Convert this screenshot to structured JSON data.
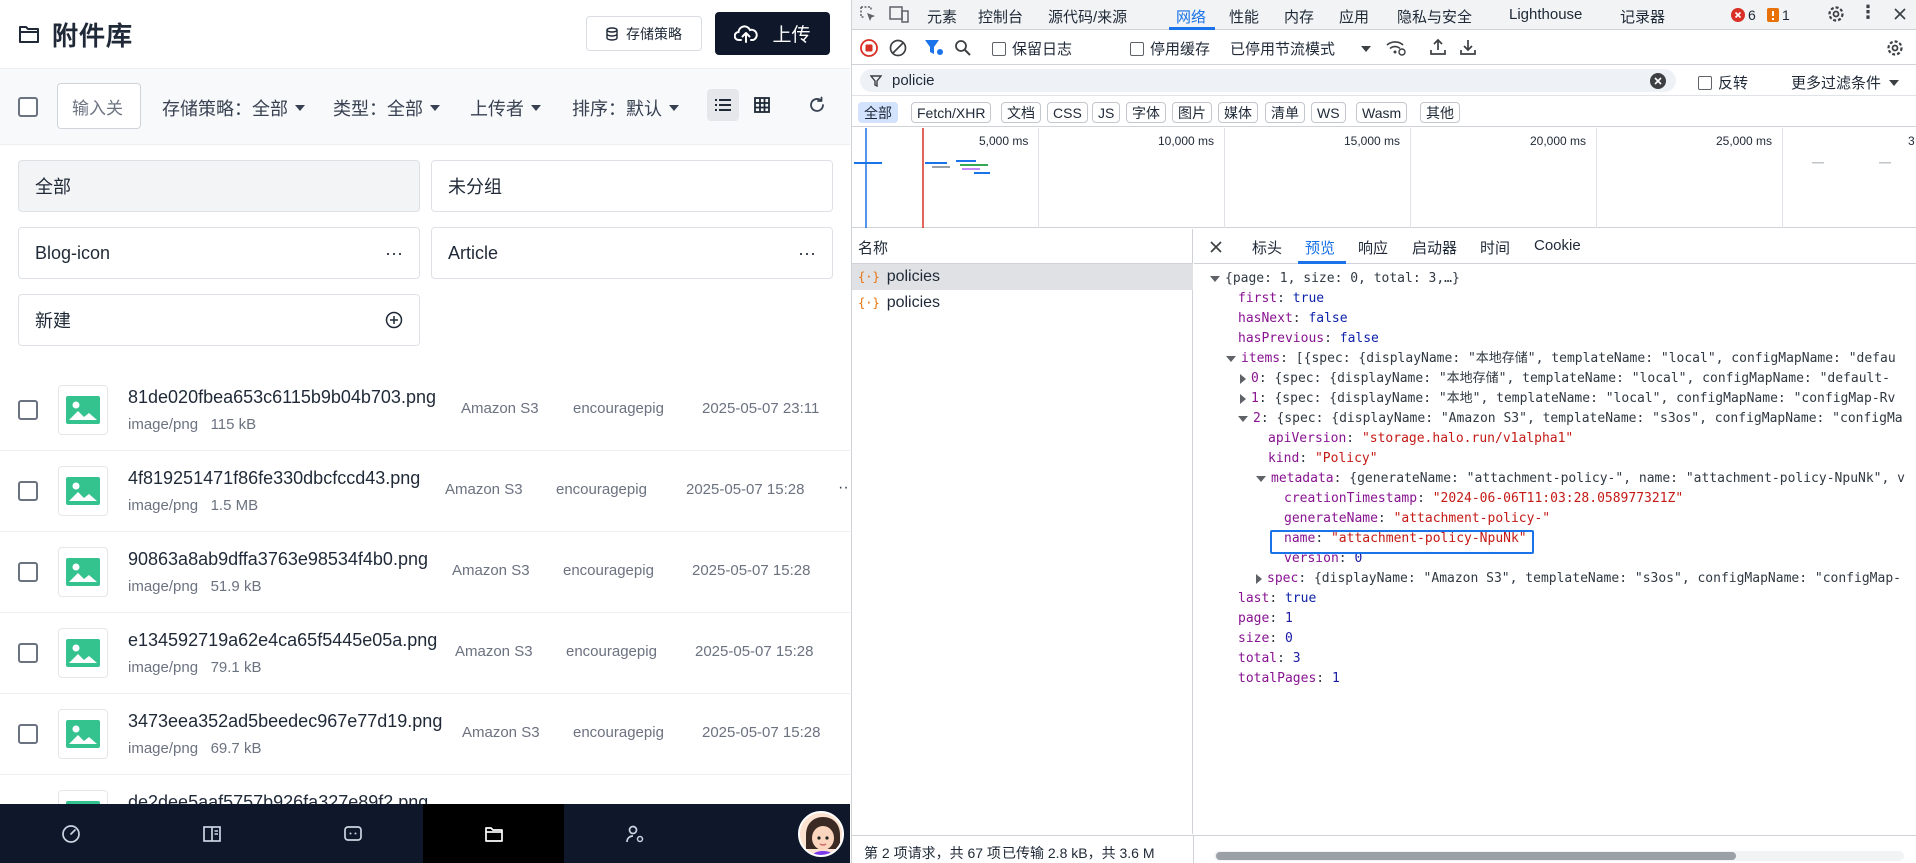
{
  "app": {
    "title": "附件库",
    "policy_button": "存储策略",
    "upload_button": "上传",
    "search_placeholder": "输入关",
    "filters": [
      {
        "label": "存储策略：全部"
      },
      {
        "label": "类型：全部"
      },
      {
        "label": "上传者"
      },
      {
        "label": "排序：默认"
      }
    ],
    "groups": [
      {
        "label": "全部"
      },
      {
        "label": "未分组"
      },
      {
        "label": "Blog-icon",
        "more": "···"
      },
      {
        "label": "Article",
        "more": "···"
      },
      {
        "label": "新建"
      }
    ],
    "files": [
      {
        "name": "81de020fbea653c6115b9b04b703.png",
        "type": "image/png",
        "size": "115 kB",
        "policy": "Amazon S3",
        "owner": "encouragepig",
        "date": "2025-05-07 23:11"
      },
      {
        "name": "4f819251471f86fe330dbcfccd43.png",
        "type": "image/png",
        "size": "1.5 MB",
        "policy": "Amazon S3",
        "owner": "encouragepig",
        "date": "2025-05-07 15:28"
      },
      {
        "name": "90863a8ab9dffa3763e98534f4b0.png",
        "type": "image/png",
        "size": "51.9 kB",
        "policy": "Amazon S3",
        "owner": "encouragepig",
        "date": "2025-05-07 15:28"
      },
      {
        "name": "e134592719a62e4ca65f5445e05a.png",
        "type": "image/png",
        "size": "79.1 kB",
        "policy": "Amazon S3",
        "owner": "encouragepig",
        "date": "2025-05-07 15:28"
      },
      {
        "name": "3473eea352ad5beedec967e77d19.png",
        "type": "image/png",
        "size": "69.7 kB",
        "policy": "Amazon S3",
        "owner": "encouragepig",
        "date": "2025-05-07 15:28"
      },
      {
        "name": "de2dee5aaf5757b926fa327e89f2.png"
      }
    ],
    "row_more": "···",
    "bottom_more": "···"
  },
  "devtools": {
    "tabs": [
      "元素",
      "控制台",
      "源代码/来源",
      "网络",
      "性能",
      "内存",
      "应用",
      "隐私与安全",
      "Lighthouse",
      "记录器"
    ],
    "error_count": "6",
    "warning_count": "1",
    "toolbar": {
      "preserve_log": "保留日志",
      "disable_cache": "停用缓存",
      "throttle": "已停用节流模式"
    },
    "filter": {
      "value": "policie",
      "invert": "反转",
      "more_filters": "更多过滤条件"
    },
    "type_filters": [
      "全部",
      "Fetch/XHR",
      "文档",
      "CSS",
      "JS",
      "字体",
      "图片",
      "媒体",
      "清单",
      "WS",
      "Wasm",
      "其他"
    ],
    "timeline_labels": [
      "5,000 ms",
      "10,000 ms",
      "15,000 ms",
      "20,000 ms",
      "25,000 ms",
      "3"
    ],
    "request_list": {
      "header": "名称",
      "rows": [
        "policies",
        "policies"
      ]
    },
    "detail_tabs": [
      "标头",
      "预览",
      "响应",
      "启动器",
      "时间",
      "Cookie"
    ],
    "preview": {
      "summary": "{page: 1, size: 0, total: 3,…}",
      "first": "true",
      "hasNext": "false",
      "hasPrevious": "false",
      "items_summary": "[{spec: {displayName: \"本地存储\", templateName: \"local\", configMapName: \"defau",
      "item0": "{spec: {displayName: \"本地存储\", templateName: \"local\", configMapName: \"default-",
      "item1": "{spec: {displayName: \"本地\", templateName: \"local\", configMapName: \"configMap-Rv",
      "item2": "{spec: {displayName: \"Amazon S3\", templateName: \"s3os\", configMapName: \"configMa",
      "apiVersion": "\"storage.halo.run/v1alpha1\"",
      "kind": "\"Policy\"",
      "metadata_summary": "{generateName: \"attachment-policy-\", name: \"attachment-policy-NpuNk\", v",
      "creationTimestamp": "\"2024-06-06T11:03:28.058977321Z\"",
      "generateName": "\"attachment-policy-\"",
      "name": "\"attachment-policy-NpuNk\"",
      "version": "0",
      "spec_summary": "{displayName: \"Amazon S3\", templateName: \"s3os\", configMapName: \"configMap-",
      "last": "true",
      "page": "1",
      "size": "0",
      "total": "3",
      "totalPages": "1"
    },
    "status": {
      "requests": "第 2 项请求，共 67 项",
      "transferred": "已传输 2.8 kB，共 3.6 M"
    }
  }
}
